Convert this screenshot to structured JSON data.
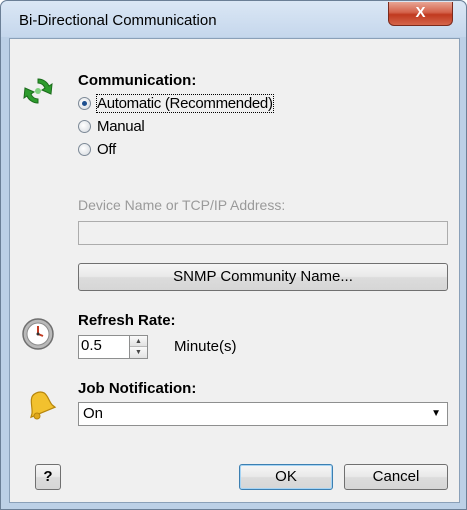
{
  "window": {
    "title": "Bi-Directional Communication",
    "close_glyph": "X"
  },
  "communication": {
    "heading": "Communication:",
    "icon": "refresh-arrows-icon",
    "options": [
      {
        "label": "Automatic (Recommended)",
        "selected": true
      },
      {
        "label": "Manual",
        "selected": false
      },
      {
        "label": "Off",
        "selected": false
      }
    ],
    "device_label": "Device Name or TCP/IP Address:",
    "device_value": "",
    "snmp_button": "SNMP Community Name..."
  },
  "refresh": {
    "heading": "Refresh Rate:",
    "icon": "clock-icon",
    "value": "0.5",
    "unit": "Minute(s)"
  },
  "notification": {
    "heading": "Job Notification:",
    "icon": "bell-icon",
    "selected": "On"
  },
  "footer": {
    "help": "?",
    "ok": "OK",
    "cancel": "Cancel"
  },
  "colors": {
    "accent_green": "#2d9b2d",
    "bell_yellow": "#f2c12e",
    "close_red": "#c7432a"
  }
}
